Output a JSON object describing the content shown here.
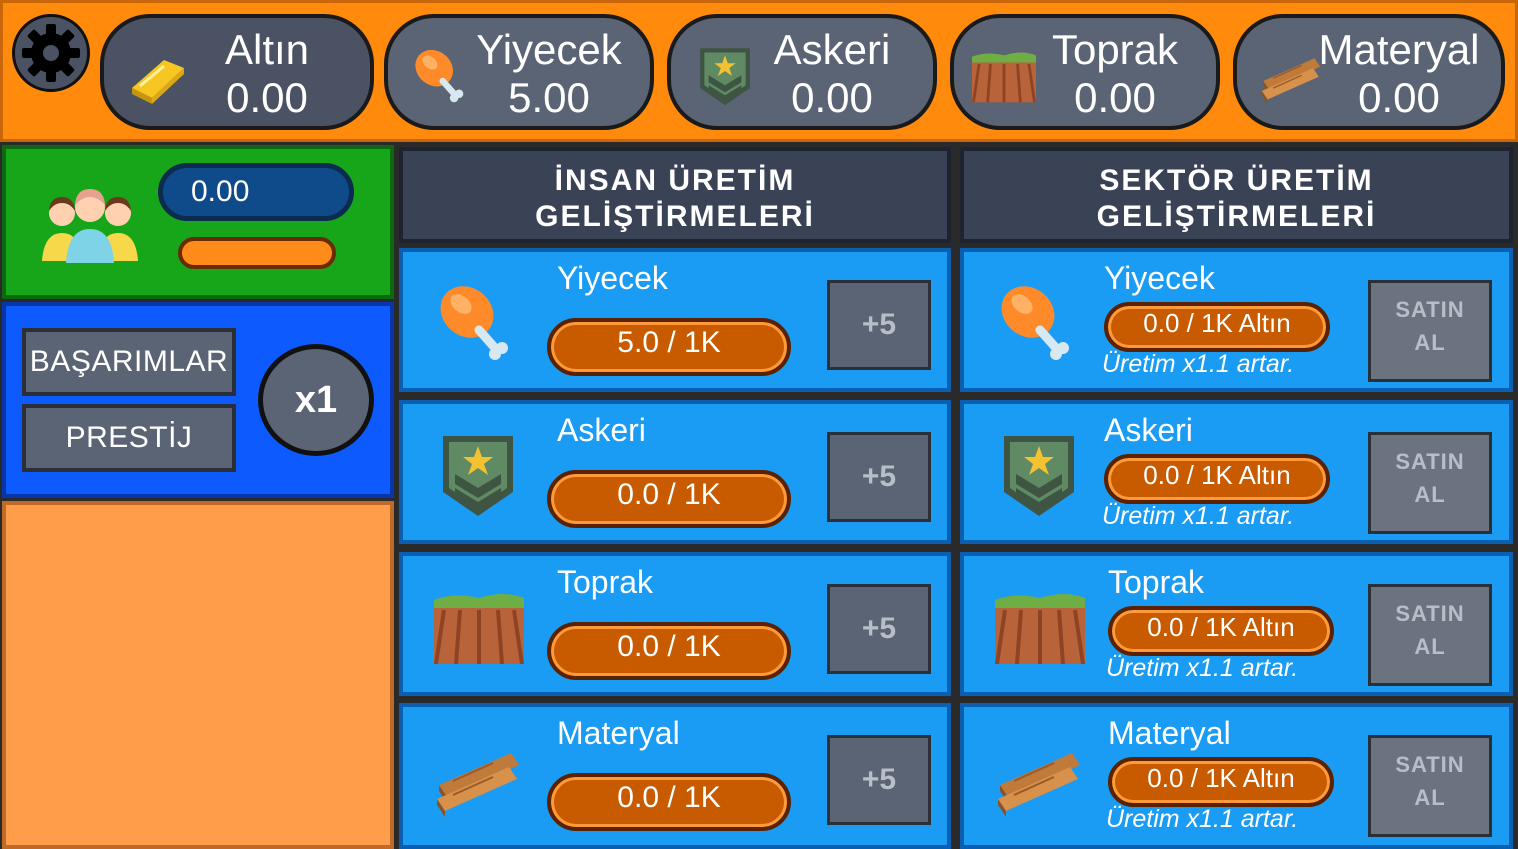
{
  "resources": [
    {
      "name": "Altın",
      "value": "0.00",
      "icon": "gold-bar-icon"
    },
    {
      "name": "Yiyecek",
      "value": "5.00",
      "icon": "drumstick-icon"
    },
    {
      "name": "Askeri",
      "value": "0.00",
      "icon": "military-badge-icon"
    },
    {
      "name": "Toprak",
      "value": "0.00",
      "icon": "soil-icon"
    },
    {
      "name": "Materyal",
      "value": "0.00",
      "icon": "wood-planks-icon"
    }
  ],
  "population": {
    "value": "0.00",
    "icon": "people-group-icon"
  },
  "left_buttons": {
    "achievements": "BAŞARIMLAR",
    "prestige": "PRESTİJ",
    "multiplier": "x1"
  },
  "human": {
    "title_line1": "İNSAN ÜRETİM",
    "title_line2": "GELİŞTİRMELERİ",
    "items": [
      {
        "name": "Yiyecek",
        "progress": "5.0 / 1K",
        "button": "+5"
      },
      {
        "name": "Askeri",
        "progress": "0.0 / 1K",
        "button": "+5"
      },
      {
        "name": "Toprak",
        "progress": "0.0 / 1K",
        "button": "+5"
      },
      {
        "name": "Materyal",
        "progress": "0.0 / 1K",
        "button": "+5"
      }
    ]
  },
  "sector": {
    "title_line1": "SEKTÖR ÜRETİM",
    "title_line2": "GELİŞTİRMELERİ",
    "items": [
      {
        "name": "Yiyecek",
        "progress": "0.0 / 1K Altın",
        "note": "Üretim x1.1 artar.",
        "btn1": "SATIN",
        "btn2": "AL"
      },
      {
        "name": "Askeri",
        "progress": "0.0 / 1K Altın",
        "note": "Üretim x1.1 artar.",
        "btn1": "SATIN",
        "btn2": "AL"
      },
      {
        "name": "Toprak",
        "progress": "0.0 / 1K Altın",
        "note": "Üretim x1.1 artar.",
        "btn1": "SATIN",
        "btn2": "AL"
      },
      {
        "name": "Materyal",
        "progress": "0.0 / 1K Altın",
        "note": "Üretim x1.1 artar.",
        "btn1": "SATIN",
        "btn2": "AL"
      }
    ]
  },
  "colors": {
    "topbar": "#ff8a0c",
    "card": "#1a9cf5",
    "green_panel": "#17a51a",
    "blue_panel": "#0d5bff",
    "peach_panel": "#ff9d4a"
  }
}
